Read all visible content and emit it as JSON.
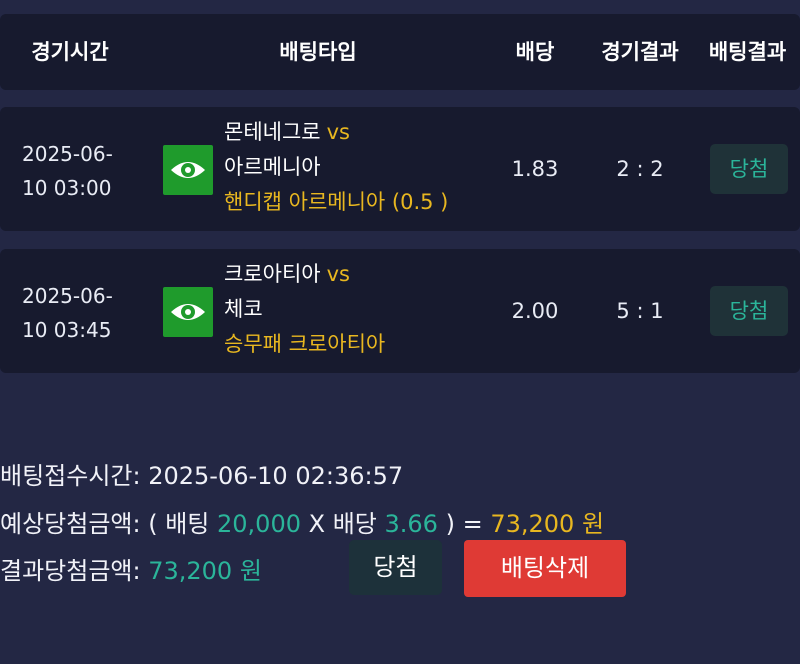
{
  "columns": {
    "time": "경기시간",
    "bet_type": "배팅타입",
    "odds": "배당",
    "game_result": "경기결과",
    "bet_result": "배팅결과"
  },
  "bets": [
    {
      "time_line1": "2025-06-",
      "time_line2": "10 03:00",
      "home": "몬테네그로",
      "vs": "vs",
      "away": "아르메니아",
      "pick": "핸디캡 아르메니아 (0.5 )",
      "odds": "1.83",
      "score": "2 : 2",
      "result": "당첨",
      "icon": "eye-icon"
    },
    {
      "time_line1": "2025-06-",
      "time_line2": "10 03:45",
      "home": "크로아티아",
      "vs": "vs",
      "away": "체코",
      "pick": "승무패 크로아티아",
      "odds": "2.00",
      "score": "5 : 1",
      "result": "당첨",
      "icon": "eye-icon"
    }
  ],
  "summary": {
    "accept_time_label": "배팅접수시간:",
    "accept_time": "2025-06-10 02:36:57",
    "expected_label": "예상당첨금액:",
    "open_paren": "( 배팅",
    "bet_amount": "20,000",
    "times": "X 배당",
    "total_odds": "3.66",
    "close_eq": ") =",
    "expected_amount": "73,200 원",
    "result_label": "결과당첨금액:",
    "result_amount": "73,200 원"
  },
  "buttons": {
    "win": "당첨",
    "delete": "배팅삭제"
  },
  "colors": {
    "background": "#232744",
    "panel": "#171a2e",
    "accent_gold": "#e8b720",
    "accent_teal": "#2bb59a",
    "eye_green": "#1f9b2c",
    "delete_red": "#df3a35"
  }
}
